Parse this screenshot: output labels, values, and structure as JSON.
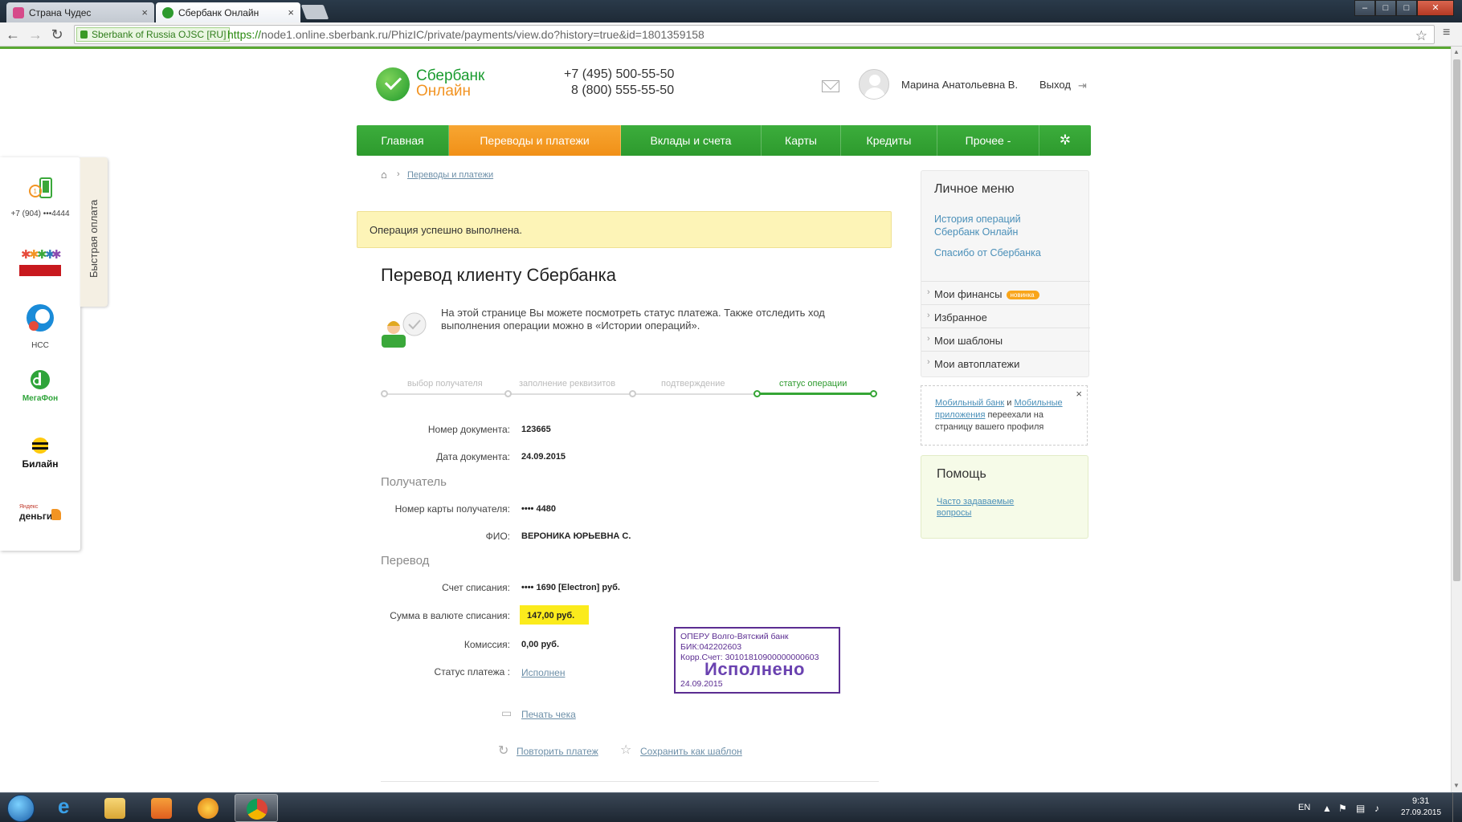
{
  "browser": {
    "tabs": [
      {
        "label": "Страна Чудес",
        "active": false
      },
      {
        "label": "Сбербанк Онлайн",
        "active": true
      }
    ],
    "tab_close": "×",
    "window_controls": {
      "minimize": "–",
      "maximize": "□",
      "close": "✕"
    },
    "nav": {
      "back": "←",
      "forward": "→",
      "reload": "↻"
    },
    "ev_badge": "Sberbank of Russia OJSC [RU]",
    "url_scheme": "https://",
    "url_host": "node1.online.sberbank.ru",
    "url_path": "/PhizIC/private/payments/view.do?history=true&id=1801359158",
    "star": "☆",
    "menu": "≡"
  },
  "quick_pay": {
    "tab_label": "Быстрая оплата",
    "items": [
      {
        "name": "phone",
        "label": "+7 (904) •••4444"
      },
      {
        "name": "charity",
        "label": ""
      },
      {
        "name": "ncc",
        "label": "НСС"
      },
      {
        "name": "megafon",
        "label": "МегаФон"
      },
      {
        "name": "beeline",
        "label": "Билайн"
      },
      {
        "name": "yandex-money",
        "label": "деньги"
      }
    ],
    "yandex_small": "Яндекс"
  },
  "header": {
    "logo_line1": "Сбербанк",
    "logo_line2": "Онлайн",
    "phone1": "+7 (495) 500-55-50",
    "phone2": "8 (800) 555-55-50",
    "user_name": "Марина Анатольевна В.",
    "logout": "Выход"
  },
  "main_nav": {
    "items": [
      "Главная",
      "Переводы и платежи",
      "Вклады и счета",
      "Карты",
      "Кредиты",
      "Прочее -"
    ],
    "settings_icon": "✲",
    "active_index": 1
  },
  "breadcrumb": {
    "home": "⌂",
    "sep": "›",
    "link": "Переводы и платежи"
  },
  "success_message": "Операция успешно выполнена.",
  "page_title": "Перевод клиенту Сбербанка",
  "info_text": "На этой странице Вы можете посмотреть статус платежа. Также отследить ход выполнения операции можно в «Истории операций».",
  "steps": [
    "выбор получателя",
    "заполнение реквизитов",
    "подтверждение",
    "статус операции"
  ],
  "details": {
    "doc_number_label": "Номер документа:",
    "doc_number": "123665",
    "doc_date_label": "Дата документа:",
    "doc_date": "24.09.2015",
    "recipient_section": "Получатель",
    "card_label": "Номер карты получателя:",
    "card_value": "•••• 4480",
    "fio_label": "ФИО:",
    "fio_value": "ВЕРОНИКА ЮРЬЕВНА С.",
    "transfer_section": "Перевод",
    "account_label": "Счет списания:",
    "account_value": "•••• 1690  [Electron]  руб.",
    "amount_label": "Сумма в валюте списания:",
    "amount_value": "147,00  руб.",
    "fee_label": "Комиссия:",
    "fee_value": "0,00 руб.",
    "status_label": "Статус платежа :",
    "status_value": "Исполнен"
  },
  "stamp": {
    "line1": "ОПЕРУ Волго-Вятский банк",
    "line2": "БИК:042202603",
    "line3": "Корр.Счет: 30101810900000000603",
    "big": "Исполнено",
    "date": "24.09.2015"
  },
  "actions": {
    "print": "Печать чека",
    "repeat": "Повторить платеж",
    "save_template": "Сохранить как шаблон"
  },
  "personal_menu": {
    "title": "Личное меню",
    "history_line1": "История операций",
    "history_line2": "Сбербанк Онлайн",
    "thanks": "Спасибо от Сбербанка",
    "items": [
      "Мои финансы",
      "Избранное",
      "Мои шаблоны",
      "Мои автоплатежи"
    ],
    "new_badge": "новинка"
  },
  "mobile_note": {
    "link1": "Мобильный банк",
    "and": " и ",
    "link2": "Мобильные приложения",
    "rest": " переехали на страницу вашего профиля",
    "close": "×"
  },
  "help": {
    "title": "Помощь",
    "faq_line1": "Часто задаваемые",
    "faq_line2": "вопросы"
  },
  "taskbar": {
    "lang": "EN",
    "time": "9:31",
    "date": "27.09.2015"
  },
  "colors": {
    "sber_green": "#2d9a2d",
    "sber_orange": "#f29423",
    "success_bg": "#fdf4b7",
    "stamp": "#5b2d91",
    "highlight": "#fbeb1c"
  }
}
